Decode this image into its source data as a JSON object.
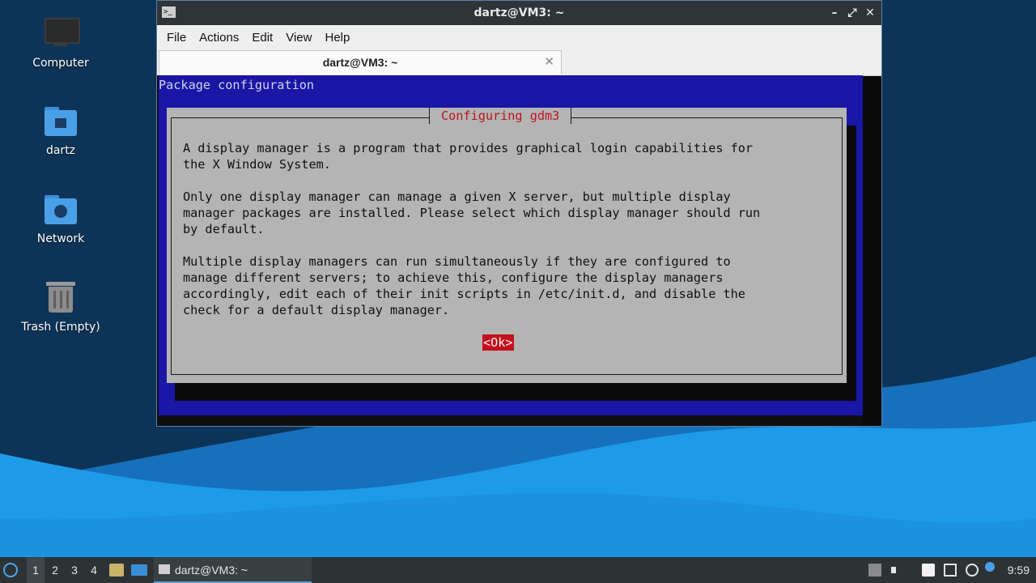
{
  "desktop": {
    "icons": [
      {
        "label": "Computer",
        "icon": "computer-icon"
      },
      {
        "label": "dartz",
        "icon": "home-folder-icon"
      },
      {
        "label": "Network",
        "icon": "network-folder-icon"
      },
      {
        "label": "Trash (Empty)",
        "icon": "trash-icon"
      }
    ]
  },
  "window": {
    "title": "dartz@VM3: ~",
    "controls": {
      "minimize": "–",
      "maximize": "⤢",
      "close": "✕"
    },
    "menu": [
      "File",
      "Actions",
      "Edit",
      "View",
      "Help"
    ],
    "tab": {
      "label": "dartz@VM3: ~",
      "close": "✕"
    }
  },
  "terminal": {
    "header": "Package configuration",
    "dialog_title": "Configuring gdm3",
    "dialog_text": "A display manager is a program that provides graphical login capabilities for\nthe X Window System.\n\nOnly one display manager can manage a given X server, but multiple display\nmanager packages are installed. Please select which display manager should run\nby default.\n\nMultiple display managers can run simultaneously if they are configured to\nmanage different servers; to achieve this, configure the display managers\naccordingly, edit each of their init scripts in /etc/init.d, and disable the\ncheck for a default display manager.",
    "ok_button": "<Ok>"
  },
  "taskbar": {
    "workspaces": [
      "1",
      "2",
      "3",
      "4"
    ],
    "active_workspace": "1",
    "task": "dartz@VM3: ~",
    "clock": "9:59"
  },
  "colors": {
    "desktop_bg": "#0d3457",
    "dialog_blue": "#1a16a6",
    "dialog_gray": "#b4b4b4",
    "accent_red": "#c4101c",
    "wave_light": "#1e9be8"
  }
}
